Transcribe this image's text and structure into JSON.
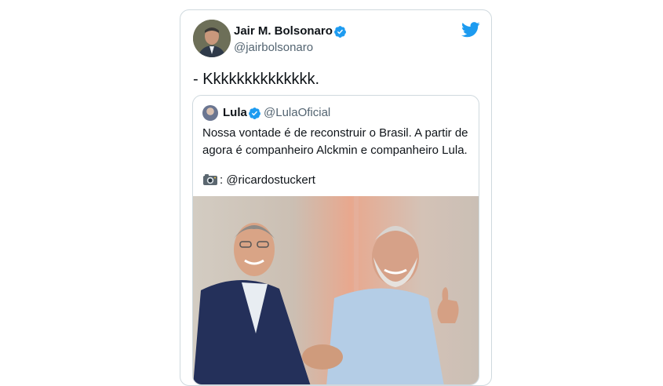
{
  "tweet": {
    "author_name": "Jair M. Bolsonaro",
    "author_handle": "@jairbolsonaro",
    "text": "- Kkkkkkkkkkkkkk.",
    "verified_color": "#1d9bf0"
  },
  "quoted_tweet": {
    "author_name": "Lula",
    "author_handle": "@LulaOficial",
    "text": "Nossa vontade é de reconstruir o Brasil. A partir de agora é companheiro Alckmin e companheiro Lula.",
    "photo_credit": ": @ricardostuckert"
  },
  "icons": {
    "brand": "twitter-bird-icon",
    "verified": "verified-badge-icon",
    "camera": "camera-icon"
  },
  "colors": {
    "twitter_blue": "#1d9bf0",
    "text_primary": "#0f1419",
    "text_secondary": "#536471",
    "border": "#cfd9de"
  }
}
